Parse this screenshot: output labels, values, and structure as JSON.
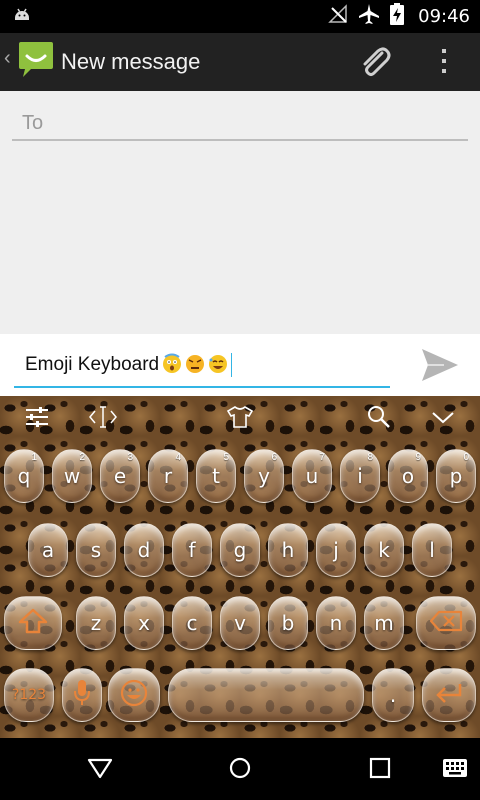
{
  "status_bar": {
    "time": "09:46",
    "icons": [
      "android-icon",
      "no-signal-icon",
      "airplane-mode-icon",
      "battery-charging-icon"
    ]
  },
  "action_bar": {
    "title": "New message",
    "app_icon": "messaging-app-icon",
    "actions": [
      "attach-icon",
      "overflow-menu-icon"
    ]
  },
  "compose": {
    "to_placeholder": "To"
  },
  "message": {
    "text": "Emoji Keyboard",
    "emojis": [
      "astonished-emoji",
      "angry-emoji",
      "laughing-emoji"
    ],
    "send_icon": "send-icon"
  },
  "keyboard": {
    "toolbar": [
      "settings-sliders-icon",
      "cursor-move-icon",
      "theme-shirt-icon",
      "search-icon",
      "hide-keyboard-icon"
    ],
    "row1": [
      {
        "label": "q",
        "hint": "1"
      },
      {
        "label": "w",
        "hint": "2"
      },
      {
        "label": "e",
        "hint": "3"
      },
      {
        "label": "r",
        "hint": "4"
      },
      {
        "label": "t",
        "hint": "5"
      },
      {
        "label": "y",
        "hint": "6"
      },
      {
        "label": "u",
        "hint": "7"
      },
      {
        "label": "i",
        "hint": "8"
      },
      {
        "label": "o",
        "hint": "9"
      },
      {
        "label": "p",
        "hint": "0"
      }
    ],
    "row2": [
      "a",
      "s",
      "d",
      "f",
      "g",
      "h",
      "j",
      "k",
      "l"
    ],
    "row3": [
      "z",
      "x",
      "c",
      "v",
      "b",
      "n",
      "m"
    ],
    "symbols_label": "?123",
    "period_label": ".",
    "accent_color": "#e8843a"
  },
  "nav_bar": {
    "icons": [
      "back-icon",
      "home-icon",
      "recents-icon",
      "keyboard-switch-icon"
    ]
  }
}
